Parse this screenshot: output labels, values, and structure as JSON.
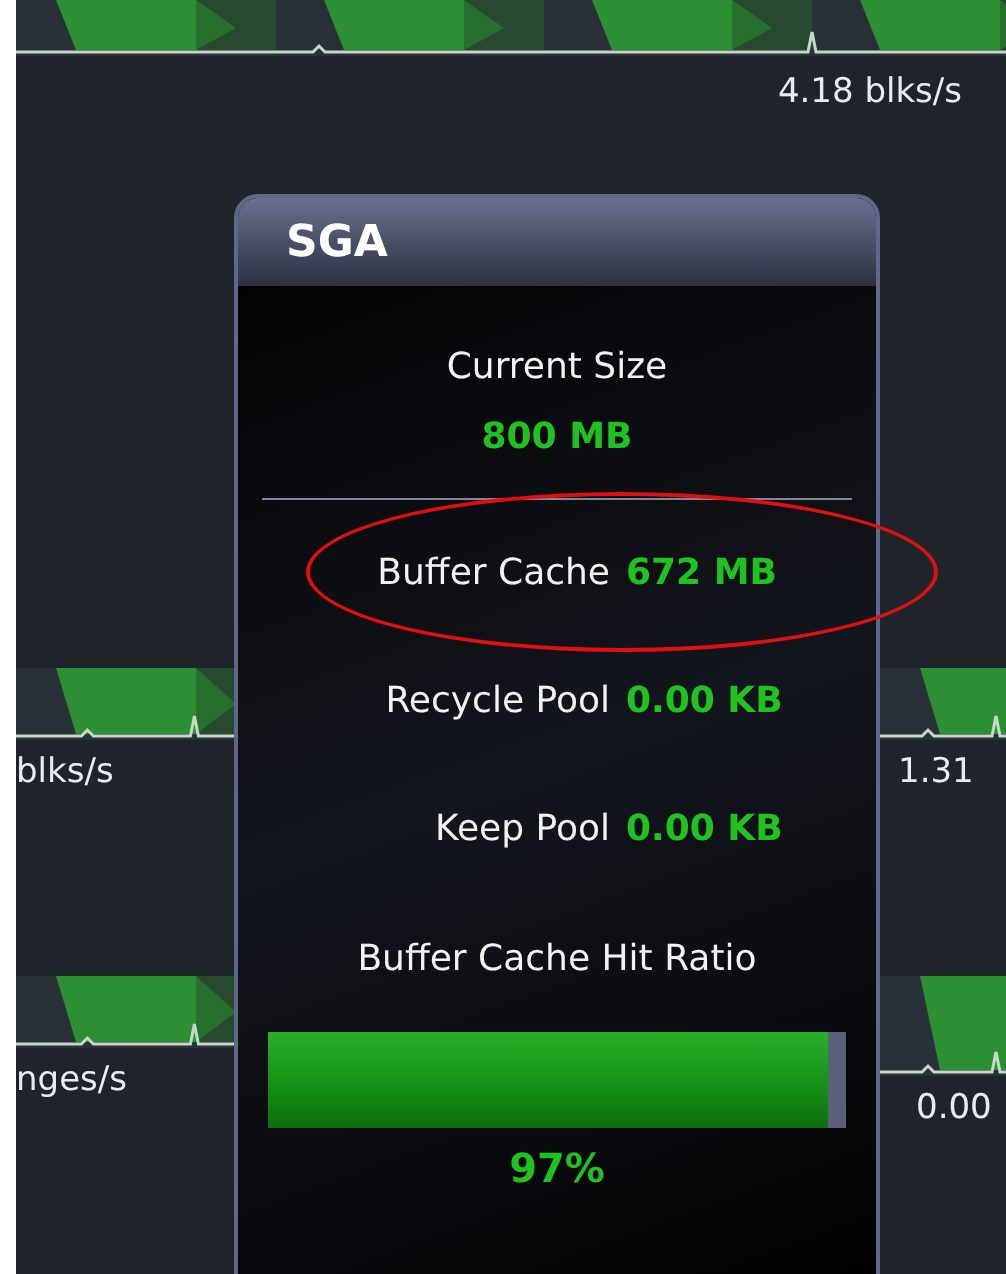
{
  "strips": [
    {
      "readouts": [
        "4.18 blks/s"
      ]
    },
    {
      "readouts": [
        "blks/s",
        "1.31"
      ]
    },
    {
      "readouts": [
        "nges/s",
        "0.00"
      ]
    }
  ],
  "panel": {
    "title": "SGA",
    "current_size": {
      "label": "Current Size",
      "value": "800 MB"
    },
    "pools": [
      {
        "label": "Buffer Cache",
        "value": "672 MB",
        "circled": true
      },
      {
        "label": "Recycle Pool",
        "value": "0.00 KB",
        "circled": false
      },
      {
        "label": "Keep Pool",
        "value": "0.00 KB",
        "circled": false
      }
    ],
    "hit_ratio": {
      "label": "Buffer Cache Hit Ratio",
      "level": 0.97,
      "reading": "97%"
    }
  }
}
